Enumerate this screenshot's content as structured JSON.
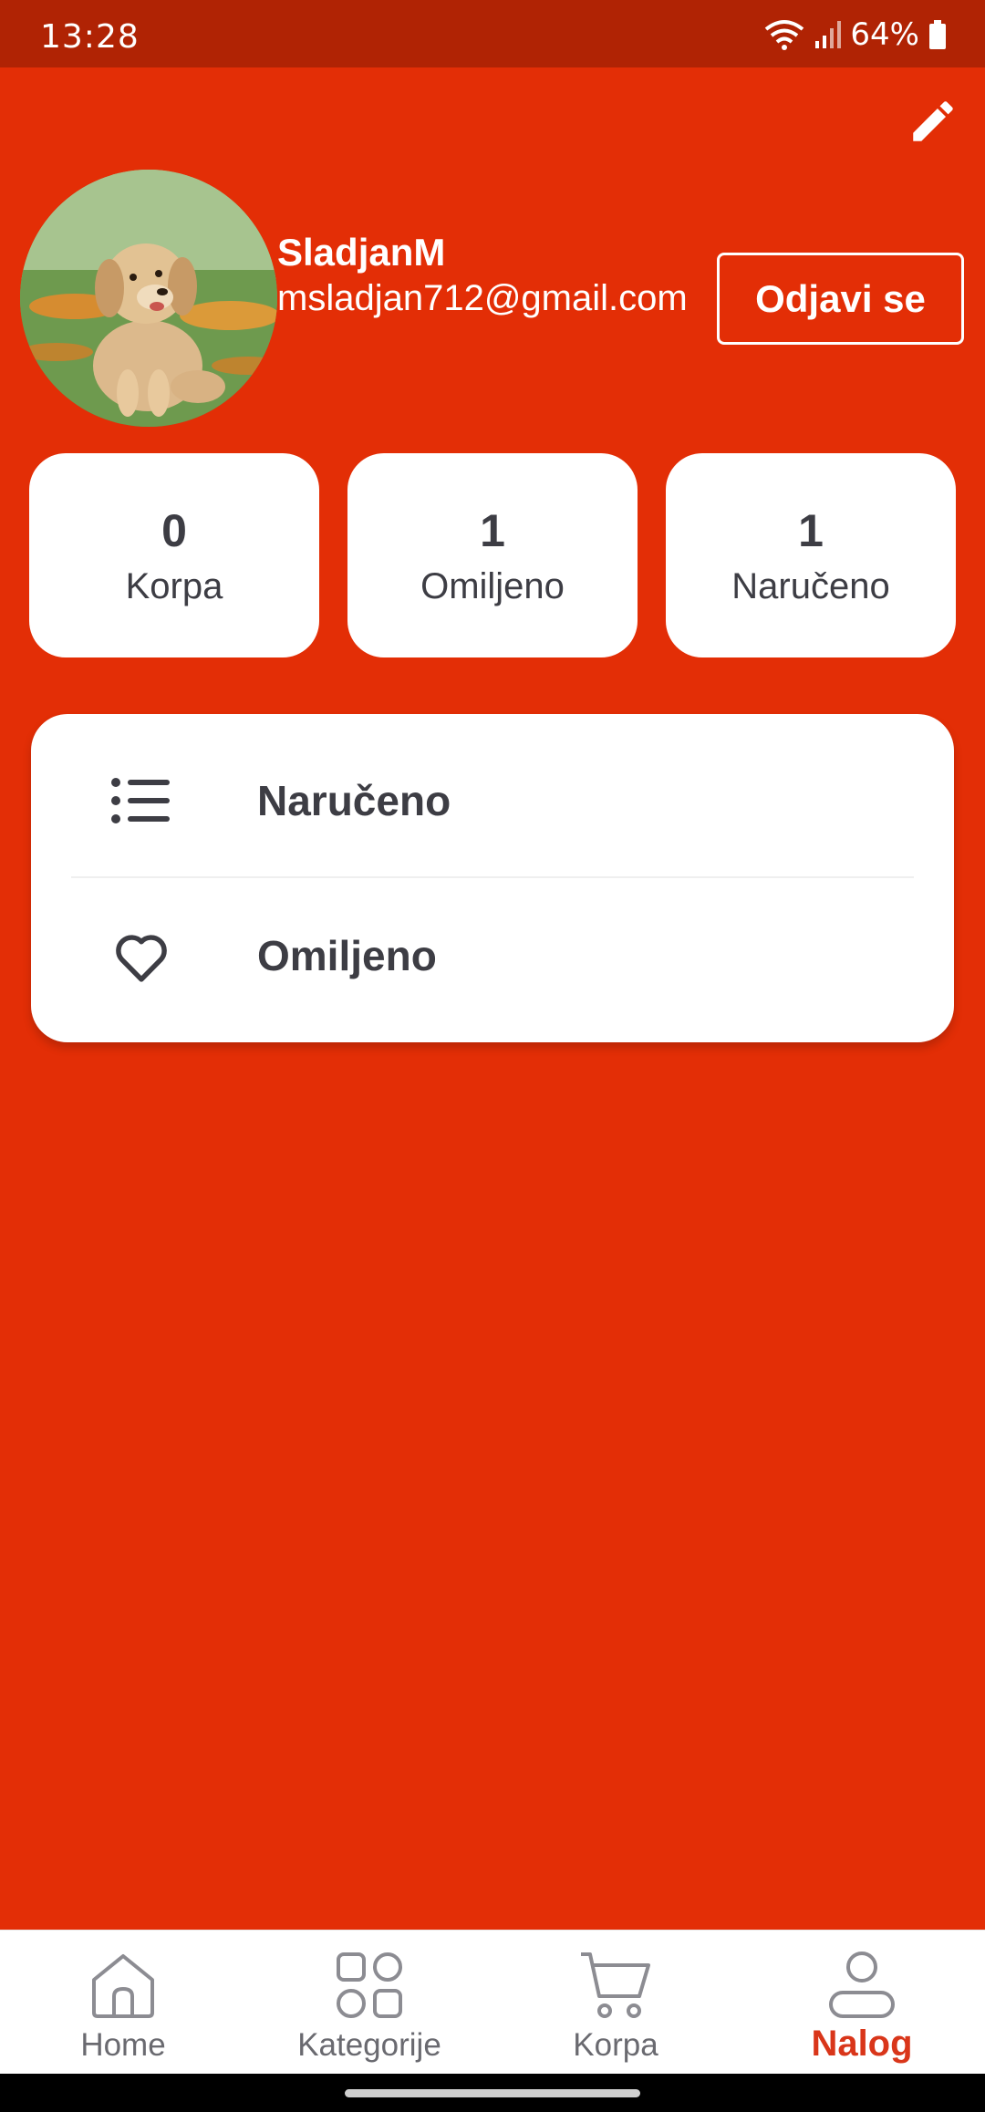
{
  "status_bar": {
    "time": "13:28",
    "battery": "64%"
  },
  "profile": {
    "username": "SladjanM",
    "email": "msladjan712@gmail.com",
    "logout_label": "Odjavi se"
  },
  "stats": [
    {
      "count": "0",
      "label": "Korpa"
    },
    {
      "count": "1",
      "label": "Omiljeno"
    },
    {
      "count": "1",
      "label": "Naručeno"
    }
  ],
  "menu": [
    {
      "label": "Naručeno",
      "icon": "list-icon"
    },
    {
      "label": "Omiljeno",
      "icon": "heart-icon"
    }
  ],
  "nav": [
    {
      "label": "Home",
      "icon": "home-icon",
      "active": false
    },
    {
      "label": "Kategorije",
      "icon": "grid-icon",
      "active": false
    },
    {
      "label": "Korpa",
      "icon": "cart-icon",
      "active": false
    },
    {
      "label": "Nalog",
      "icon": "user-icon",
      "active": true
    }
  ],
  "colors": {
    "accent": "#E32E06",
    "status_bar": "#B02304",
    "active_nav": "#D9361A"
  }
}
